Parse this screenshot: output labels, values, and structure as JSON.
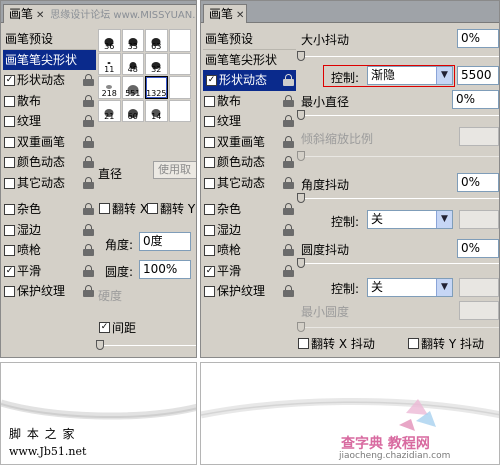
{
  "left_panel": {
    "tab_label": "画笔",
    "tab_watermark": "思缘设计论坛 www.MISSYUAN.COM",
    "list_items": [
      {
        "label": "画笔预设",
        "type": "header"
      },
      {
        "label": "画笔笔尖形状",
        "type": "selected"
      },
      {
        "label": "形状动态",
        "checked": true
      },
      {
        "label": "散布",
        "checked": false
      },
      {
        "label": "纹理",
        "checked": false
      },
      {
        "label": "双重画笔",
        "checked": false
      },
      {
        "label": "颜色动态",
        "checked": false
      },
      {
        "label": "其它动态",
        "checked": false
      },
      {
        "label": "杂色",
        "checked": false
      },
      {
        "label": "湿边",
        "checked": false
      },
      {
        "label": "喷枪",
        "checked": false
      },
      {
        "label": "平滑",
        "checked": true
      },
      {
        "label": "保护纹理",
        "checked": false
      }
    ],
    "brush_tips": [
      {
        "size": "36"
      },
      {
        "size": "33"
      },
      {
        "size": "63"
      },
      {
        "size": ""
      },
      {
        "size": "11"
      },
      {
        "size": "48"
      },
      {
        "size": "32"
      },
      {
        "size": ""
      },
      {
        "size": "218"
      },
      {
        "size": "551"
      },
      {
        "size": "1325"
      },
      {
        "size": ""
      },
      {
        "size": "21"
      },
      {
        "size": "60"
      },
      {
        "size": "14"
      },
      {
        "size": ""
      }
    ],
    "diameter_label": "直径",
    "use_sample_button": "使用取",
    "flip_x_label": "翻转 X",
    "flip_y_label": "翻转 Y",
    "angle_label": "角度:",
    "angle_value": "0度",
    "roundness_label": "圆度:",
    "roundness_value": "100%",
    "hardness_label": "硬度",
    "spacing_label": "间距",
    "spacing_checked": true
  },
  "right_panel": {
    "tab_label": "画笔",
    "list_items": [
      {
        "label": "画笔预设",
        "type": "header"
      },
      {
        "label": "画笔笔尖形状",
        "type": "plain"
      },
      {
        "label": "形状动态",
        "checked": true,
        "type": "selected"
      },
      {
        "label": "散布",
        "checked": false
      },
      {
        "label": "纹理",
        "checked": false
      },
      {
        "label": "双重画笔",
        "checked": false
      },
      {
        "label": "颜色动态",
        "checked": false
      },
      {
        "label": "其它动态",
        "checked": false
      },
      {
        "label": "杂色",
        "checked": false
      },
      {
        "label": "湿边",
        "checked": false
      },
      {
        "label": "喷枪",
        "checked": false
      },
      {
        "label": "平滑",
        "checked": true
      },
      {
        "label": "保护纹理",
        "checked": false
      }
    ],
    "size_jitter_label": "大小抖动",
    "size_jitter_value": "0%",
    "control_label": "控制:",
    "control_value": "渐隐",
    "fade_steps": "5500",
    "min_diameter_label": "最小直径",
    "min_diameter_value": "0%",
    "tilt_scale_label": "倾斜缩放比例",
    "angle_jitter_label": "角度抖动",
    "angle_jitter_value": "0%",
    "angle_control_label": "控制:",
    "angle_control_value": "关",
    "roundness_jitter_label": "圆度抖动",
    "roundness_jitter_value": "0%",
    "roundness_control_label": "控制:",
    "roundness_control_value": "关",
    "min_roundness_label": "最小圆度",
    "flip_x_jitter_label": "翻转 X 抖动",
    "flip_y_jitter_label": "翻转 Y 抖动"
  },
  "watermarks": {
    "left_name": "脚 本 之 家",
    "left_url": "www.Jb51.net",
    "right_name": "查字典 教程网",
    "right_url": "jiaocheng.chazidian.com"
  },
  "colors": {
    "panel_bg": "#d4d0c8",
    "selection": "#0a2a8c",
    "highlight_box": "#dd0000",
    "watermark_pink": "#d86aa0"
  }
}
